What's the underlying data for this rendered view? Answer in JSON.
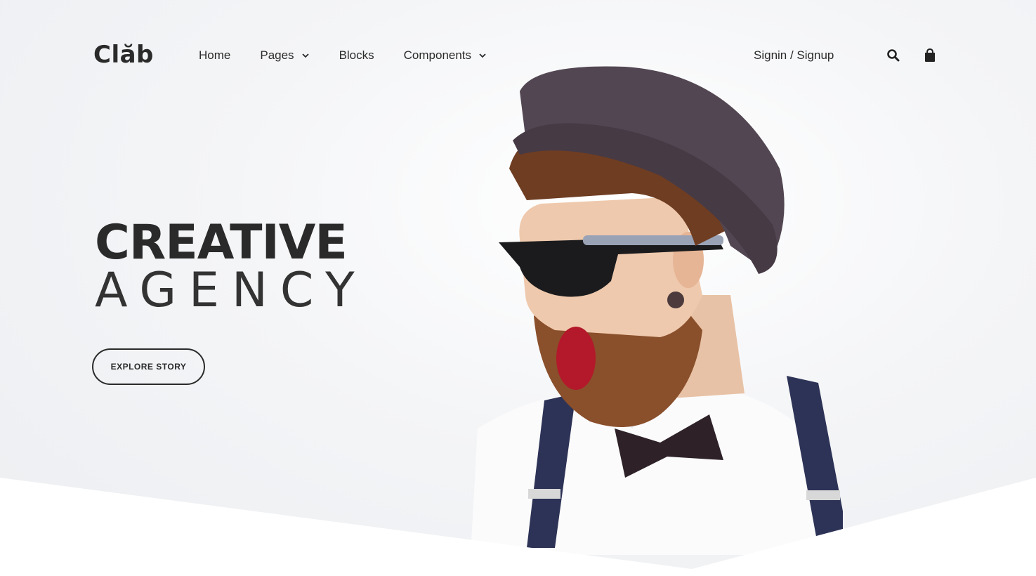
{
  "brand": {
    "name": "Clăb"
  },
  "nav": {
    "items": [
      {
        "label": "Home",
        "dropdown": false
      },
      {
        "label": "Pages",
        "dropdown": true
      },
      {
        "label": "Blocks",
        "dropdown": false
      },
      {
        "label": "Components",
        "dropdown": true
      }
    ],
    "signin_label": "Signin / Signup",
    "icons": [
      "search-icon",
      "shopping-bag-icon"
    ]
  },
  "hero": {
    "title_line1": "CREATIVE",
    "title_line2": "AGENCY",
    "cta_label": "EXPLORE STORY"
  },
  "colors": {
    "text": "#2a2a2a",
    "background": "#eceef1"
  }
}
